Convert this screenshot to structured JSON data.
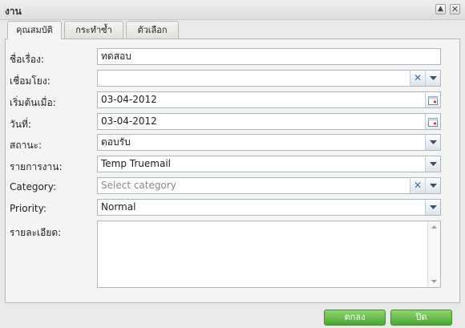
{
  "window": {
    "title": "งาน"
  },
  "tabs": [
    {
      "label": "คุณสมบัติ",
      "active": true
    },
    {
      "label": "กระทำซ้ำ",
      "active": false
    },
    {
      "label": "ตัวเลือก",
      "active": false
    }
  ],
  "form": {
    "subject": {
      "label": "ชื่อเรื่อง:",
      "value": "ทดสอบ"
    },
    "link": {
      "label": "เชื่อมโยง:",
      "value": ""
    },
    "start": {
      "label": "เริ่มต้นเมื่อ:",
      "value": "03-04-2012"
    },
    "date": {
      "label": "วันที่:",
      "value": "03-04-2012"
    },
    "status": {
      "label": "สถานะ:",
      "value": "ตอบรับ"
    },
    "tasklist": {
      "label": "รายการงาน:",
      "value": "Temp Truemail"
    },
    "category": {
      "label": "Category:",
      "placeholder": "Select category"
    },
    "priority": {
      "label": "Priority:",
      "value": "Normal"
    },
    "details": {
      "label": "รายละเอียด:",
      "value": ""
    }
  },
  "buttons": {
    "ok": "ตกลง",
    "close": "ปิด"
  },
  "colors": {
    "accent": "#3b6ea5",
    "button_green": "#4ba534"
  }
}
